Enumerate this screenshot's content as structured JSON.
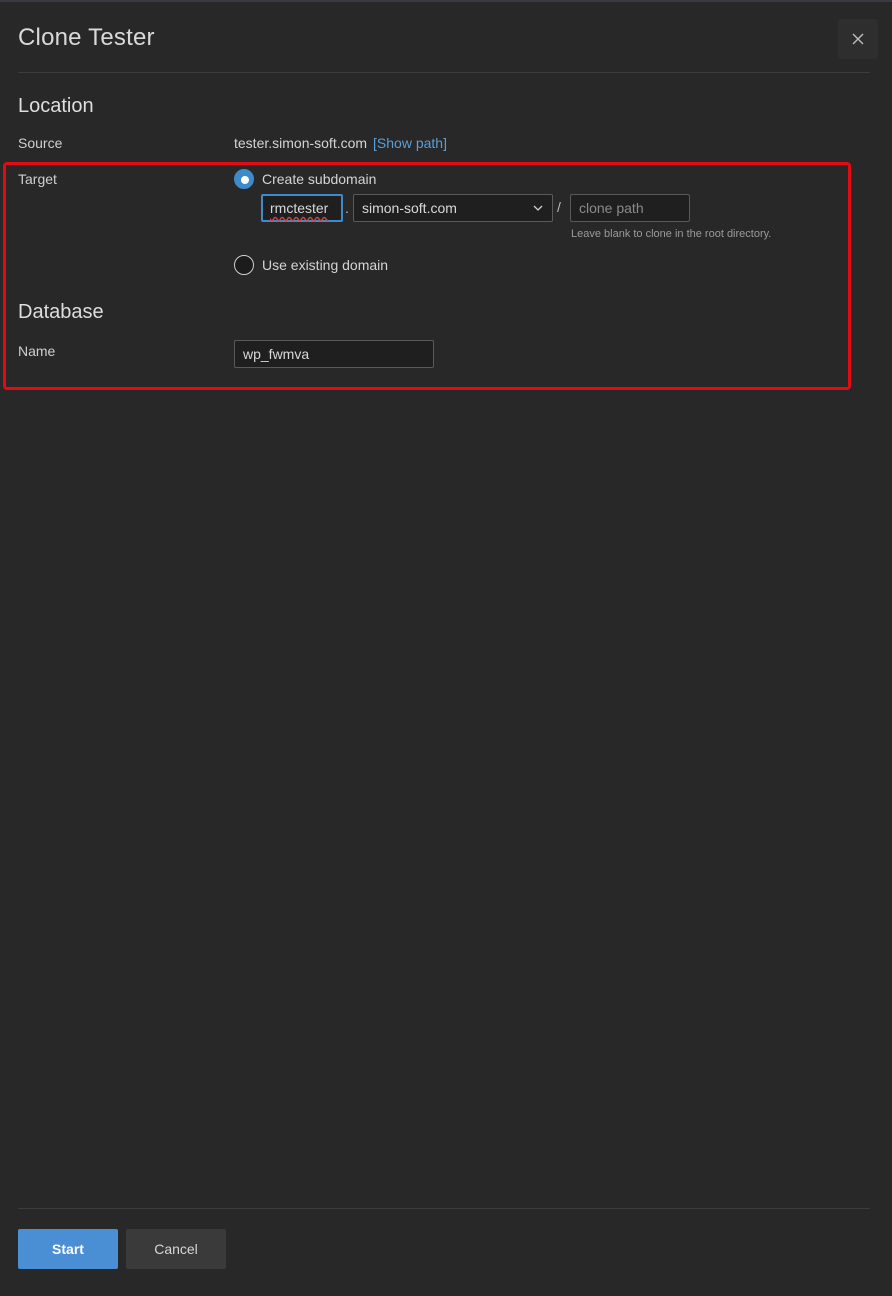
{
  "dialog": {
    "title": "Clone Tester",
    "close_label": "×"
  },
  "location": {
    "heading": "Location",
    "source_label": "Source",
    "source_value": "tester.simon-soft.com",
    "show_path_link": "[Show path]",
    "target_label": "Target",
    "option_create_subdomain": "Create subdomain",
    "subdomain_value": "rmctester",
    "dot_separator": ".",
    "domain_select_value": "simon-soft.com",
    "slash_separator": "/",
    "clone_path_placeholder": "clone path",
    "clone_path_hint": "Leave blank to clone in the root directory.",
    "option_use_existing": "Use existing domain",
    "selected_option": "Create subdomain"
  },
  "database": {
    "heading": "Database",
    "name_label": "Name",
    "name_value": "wp_fwmva"
  },
  "footer": {
    "start_label": "Start",
    "cancel_label": "Cancel"
  },
  "colors": {
    "background": "#282828",
    "accent": "#4a8fd4",
    "link": "#5a9fd6",
    "highlight_border": "#e30b13"
  }
}
